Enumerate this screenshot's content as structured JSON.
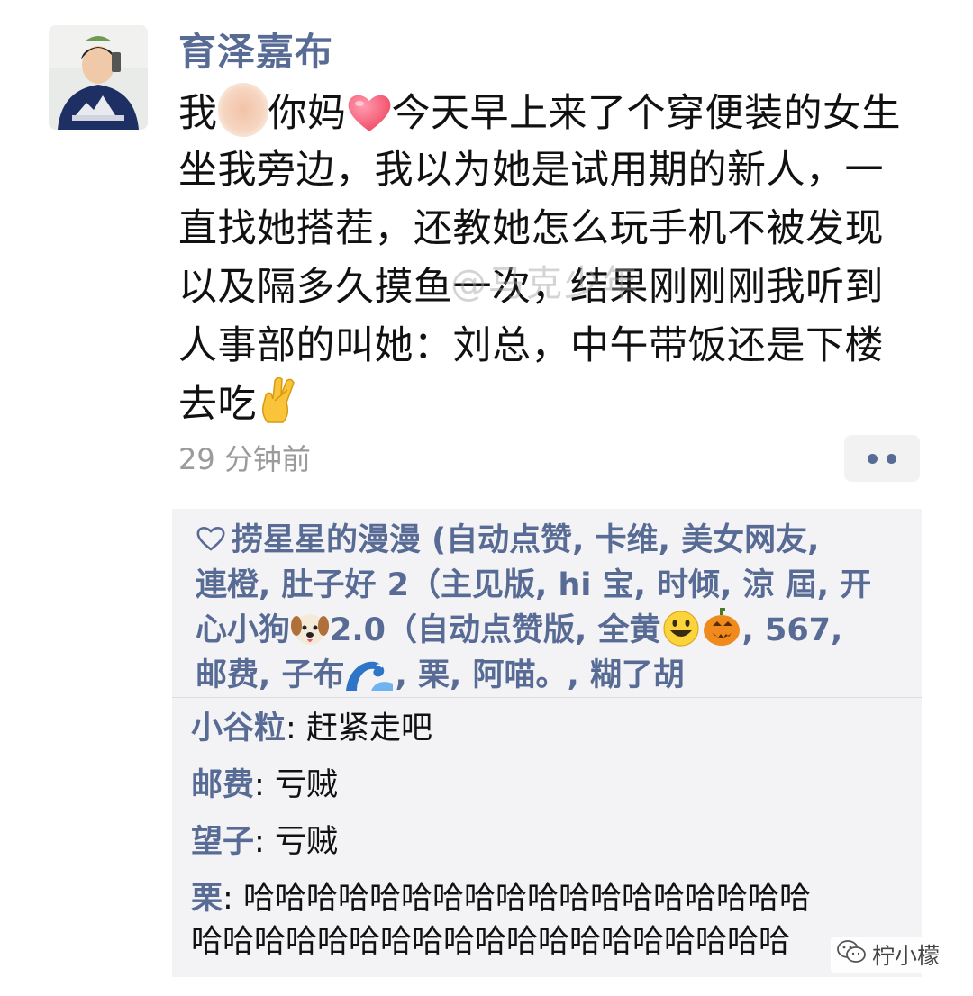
{
  "author": {
    "name": "育泽嘉布"
  },
  "post": {
    "lines": [
      {
        "before": "我",
        "middle": "你妈",
        "after": "今天早上来了个穿便装的女生"
      },
      "坐我旁边，我以为她是试用期的新人，一",
      "直找她搭茬，还教她怎么玩手机不被发现",
      "以及隔多久摸鱼一次，结果刚刚刚我听到",
      "人事部的叫她：刘总，中午带饭还是下楼",
      "去吃"
    ],
    "watermark": "@马克少年",
    "timestamp": "29 分钟前"
  },
  "likes": {
    "line1": "捞星星的漫漫 (自动点赞, 卡维, 美女网友,",
    "line2": "連橙, 肚子好 2（主见版, hi 宝, 时倾, 涼 屆, 开",
    "line3_a": "心小狗",
    "line3_b": "2.0（自动点赞版, 全黄",
    "line3_c": ", 567,",
    "line4_a": "邮费, 子布",
    "line4_b": ", 栗, 阿喵。, 糊了胡"
  },
  "comments": [
    {
      "who": "小谷粒",
      "sep": ": ",
      "text": "赶紧走吧"
    },
    {
      "who": "邮费",
      "sep": ": ",
      "text": "亏贼"
    },
    {
      "who": "望子",
      "sep": ": ",
      "text": "亏贼"
    },
    {
      "who": "栗",
      "sep": ": ",
      "text": "哈哈哈哈哈哈哈哈哈哈哈哈哈哈哈哈哈哈"
    },
    {
      "who": "",
      "sep": "",
      "text": "哈哈哈哈哈哈哈哈哈哈哈哈哈哈哈哈哈哈哈"
    }
  ],
  "footer": {
    "account": "柠小檬"
  },
  "colors": {
    "link_blue": "#576b95",
    "panel_bg": "#f3f3f5",
    "timestamp_gray": "#9b9b9b"
  },
  "icons": [
    "avatar-photo",
    "heart-emoji",
    "crossed-fingers-emoji",
    "heart-outline-icon",
    "dog-face-emoji",
    "smiley-emoji",
    "jack-o-lantern-emoji",
    "water-wave-emoji",
    "wechat-icon"
  ]
}
